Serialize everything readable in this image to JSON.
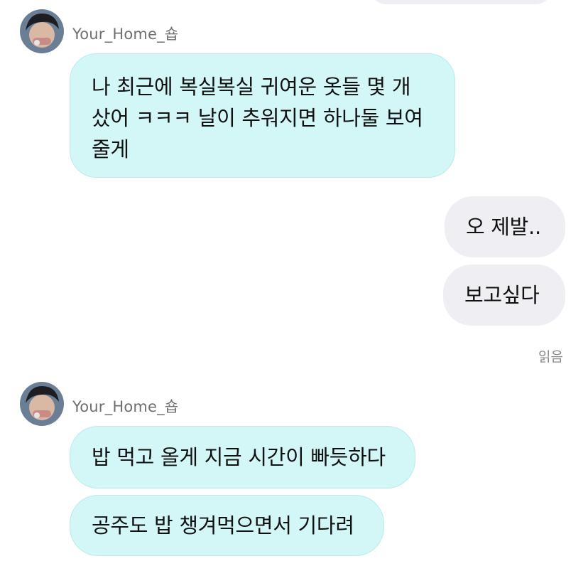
{
  "thread": {
    "group1": {
      "sender": "Your_Home_숍",
      "avatar_icon": "profile-photo-avatar",
      "message_lines": [
        "나 최근에 복실복실 귀여운 옷들 몇 개",
        "샀어 ㅋㅋㅋ 날이 추워지면 하나둘 보여",
        "줄게"
      ]
    },
    "outgoing": [
      {
        "text": "오 제발.."
      },
      {
        "text": "보고싶다"
      }
    ],
    "read_receipt": "읽음",
    "group2": {
      "sender": "Your_Home_숍",
      "avatar_icon": "profile-photo-avatar",
      "messages": [
        {
          "text": "밥 먹고 올게 지금 시간이 빠듯하다"
        },
        {
          "text": "공주도 밥 챙겨먹으면서 기다려"
        }
      ]
    }
  },
  "colors": {
    "incoming_bubble": "#d3f6f6",
    "outgoing_bubble": "#efeff3",
    "sender_text": "#6f6f6f",
    "read_text": "#8a8a8a"
  }
}
